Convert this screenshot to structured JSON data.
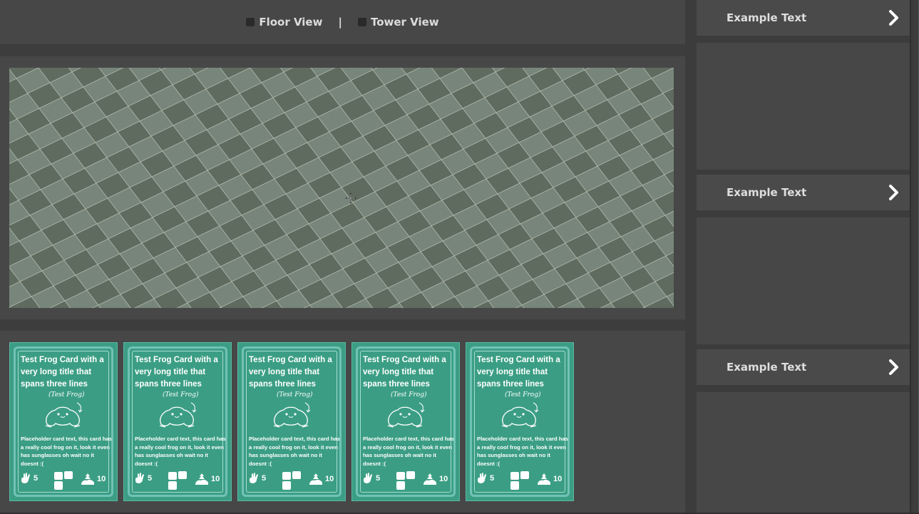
{
  "header": {
    "floor_view_label": "Floor View",
    "separator": "|",
    "tower_view_label": "Tower View"
  },
  "viewport": {
    "tile_color_dark": "#5f6b5e",
    "tile_color_light": "#77857a",
    "grid_line_color": "#b9c3b6"
  },
  "hand": {
    "cards": [
      {
        "title": "Test Frog Card with a very long title that spans three lines",
        "art_label": "(Test Frog)",
        "body": "Placeholder card text, this card has a really cool frog on it, look it even has sunglasses oh wait no it doesnt :(",
        "stat_left": "5",
        "stat_right": "10"
      },
      {
        "title": "Test Frog Card with a very long title that spans three lines",
        "art_label": "(Test Frog)",
        "body": "Placeholder card text, this card has a really cool frog on it, look it even has sunglasses oh wait no it doesnt :(",
        "stat_left": "5",
        "stat_right": "10"
      },
      {
        "title": "Test Frog Card with a very long title that spans three lines",
        "art_label": "(Test Frog)",
        "body": "Placeholder card text, this card has a really cool frog on it, look it even has sunglasses oh wait no it doesnt :(",
        "stat_left": "5",
        "stat_right": "10"
      },
      {
        "title": "Test Frog Card with a very long title that spans three lines",
        "art_label": "(Test Frog)",
        "body": "Placeholder card text, this card has a really cool frog on it, look it even has sunglasses oh wait no it doesnt :(",
        "stat_left": "5",
        "stat_right": "10"
      },
      {
        "title": "Test Frog Card with a very long title that spans three lines",
        "art_label": "(Test Frog)",
        "body": "Placeholder card text, this card has a really cool frog on it, look it even has sunglasses oh wait no it doesnt :(",
        "stat_left": "5",
        "stat_right": "10"
      }
    ],
    "card_color": "#3b9e84"
  },
  "sidebar": {
    "sections": [
      {
        "label": "Example Text",
        "icon": "chevron-right-icon"
      },
      {
        "label": "Example Text",
        "icon": "chevron-right-icon"
      },
      {
        "label": "Example Text",
        "icon": "chevron-right-icon"
      }
    ]
  }
}
